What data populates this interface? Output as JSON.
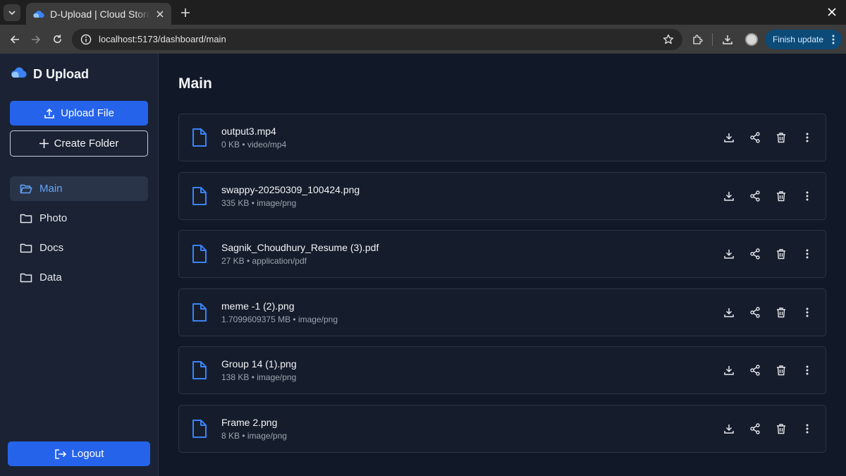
{
  "browser": {
    "tab_title": "D-Upload | Cloud Storage",
    "url": "localhost:5173/dashboard/main",
    "finish_update_label": "Finish update"
  },
  "brand": {
    "name": "D Upload",
    "accent": "#2563eb"
  },
  "sidebar": {
    "upload_label": "Upload File",
    "create_folder_label": "Create Folder",
    "items": [
      {
        "label": "Main",
        "icon": "folder-open-icon",
        "active": true
      },
      {
        "label": "Photo",
        "icon": "folder-icon",
        "active": false
      },
      {
        "label": "Docs",
        "icon": "folder-icon",
        "active": false
      },
      {
        "label": "Data",
        "icon": "folder-icon",
        "active": false
      }
    ],
    "logout_label": "Logout"
  },
  "main": {
    "title": "Main",
    "files": [
      {
        "name": "output3.mp4",
        "meta": "0 KB • video/mp4"
      },
      {
        "name": "swappy-20250309_100424.png",
        "meta": "335 KB • image/png"
      },
      {
        "name": "Sagnik_Choudhury_Resume (3).pdf",
        "meta": "27 KB • application/pdf"
      },
      {
        "name": "meme -1 (2).png",
        "meta": "1.7099609375 MB • image/png"
      },
      {
        "name": "Group 14 (1).png",
        "meta": "138 KB • image/png"
      },
      {
        "name": "Frame 2.png",
        "meta": "8 KB • image/png"
      }
    ]
  }
}
